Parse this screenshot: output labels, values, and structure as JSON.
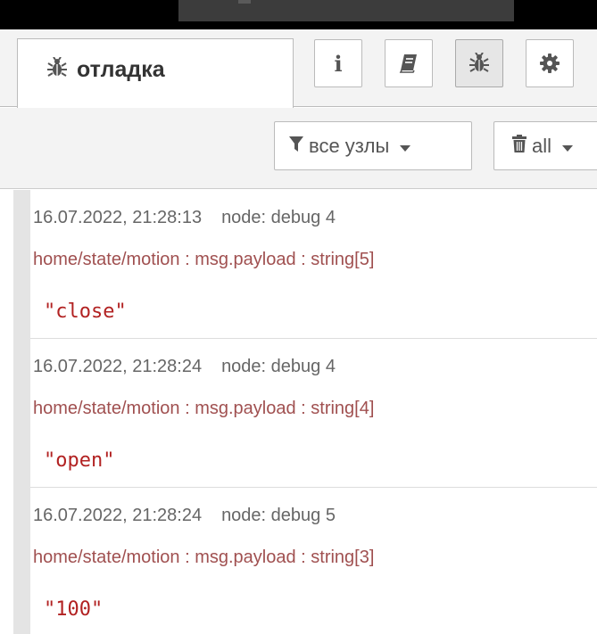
{
  "header": {
    "active_tab_label": "отладка",
    "buttons": [
      {
        "name": "info-button",
        "icon": "info-icon",
        "glyph": "i"
      },
      {
        "name": "help-button",
        "icon": "book-icon"
      },
      {
        "name": "debug-button",
        "icon": "bug-icon",
        "selected": true
      },
      {
        "name": "config-button",
        "icon": "gear-icon"
      }
    ]
  },
  "toolbar": {
    "filter_label": "все узлы",
    "clear_label": "all"
  },
  "messages": [
    {
      "timestamp": "16.07.2022, 21:28:13",
      "node": "node: debug 4",
      "topic": "home/state/motion : msg.payload : string[5]",
      "payload": "\"close\""
    },
    {
      "timestamp": "16.07.2022, 21:28:24",
      "node": "node: debug 4",
      "topic": "home/state/motion : msg.payload : string[4]",
      "payload": "\"open\""
    },
    {
      "timestamp": "16.07.2022, 21:28:24",
      "node": "node: debug 5",
      "topic": "home/state/motion : msg.payload : string[3]",
      "payload": "\"100\""
    }
  ],
  "colors": {
    "topic": "#a05050",
    "payload_string": "#b22222",
    "meta": "#666666"
  }
}
